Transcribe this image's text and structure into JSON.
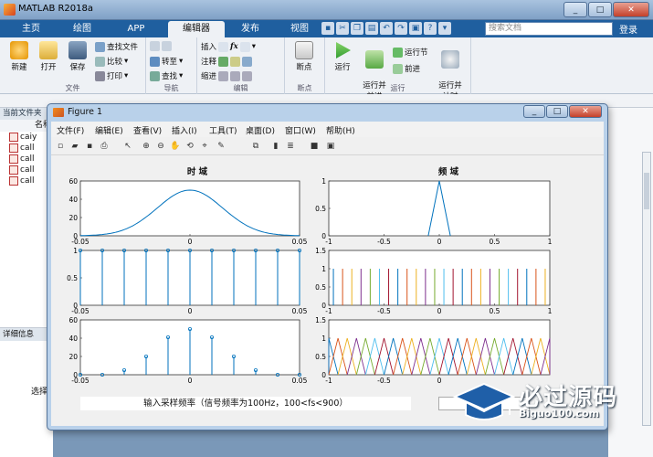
{
  "window": {
    "title": "MATLAB R2018a"
  },
  "tabs": [
    "主页",
    "绘图",
    "APP",
    "编辑器",
    "发布",
    "视图"
  ],
  "search": {
    "placeholder": "搜索文档"
  },
  "login_label": "登录",
  "ribbon": {
    "file": {
      "label": "文件",
      "new": "新建",
      "open": "打开",
      "save": "保存",
      "find_files": "查找文件",
      "compare": "比较",
      "print": "打印"
    },
    "navigate": {
      "label": "导航",
      "goto": "转至",
      "find": "查找"
    },
    "edit": {
      "label": "编辑",
      "insert": "插入",
      "comment": "注释",
      "indent": "缩进"
    },
    "breakpoints": {
      "label": "断点",
      "breakpoints_btn": "断点"
    },
    "run": {
      "label": "运行",
      "run": "运行",
      "run_advance": "运行并\n前进",
      "run_section": "运行节",
      "advance": "前进",
      "run_time": "运行并\n计时"
    }
  },
  "current_folder": {
    "label": "当前文件夹",
    "column": "名称",
    "files": [
      "caiy",
      "call",
      "call",
      "call",
      "call"
    ]
  },
  "details_panel": {
    "label": "详细信息",
    "select_text": "选择"
  },
  "figure": {
    "title": "Figure 1",
    "menus": [
      "文件(F)",
      "编辑(E)",
      "查看(V)",
      "插入(I)",
      "工具(T)",
      "桌面(D)",
      "窗口(W)",
      "帮助(H)"
    ],
    "plot_titles": {
      "time": "时 域",
      "freq": "频 域"
    },
    "fs_label": "输入采样频率（信号频率为100Hz，100<fs<900）",
    "fs_input_value": ""
  },
  "chart_data": [
    {
      "type": "line",
      "title": "时 域",
      "x": [
        -0.05,
        -0.04,
        -0.03,
        -0.02,
        -0.01,
        0,
        0.01,
        0.02,
        0.03,
        0.04,
        0.05
      ],
      "y": [
        0.4,
        3,
        11,
        26,
        42,
        50,
        42,
        26,
        11,
        3,
        0.4
      ],
      "xlim": [
        -0.05,
        0.05
      ],
      "ylim": [
        0,
        60
      ],
      "xticks": [
        "-0.05",
        "0",
        "0.05"
      ],
      "yticks": [
        "0",
        "20",
        "40",
        "60"
      ]
    },
    {
      "type": "line",
      "title": "频 域",
      "x": [
        -0.1,
        0,
        0.1
      ],
      "y": [
        0,
        1,
        0
      ],
      "xlim": [
        -1,
        1
      ],
      "ylim": [
        0,
        1
      ],
      "xticks": [
        "-1",
        "-0.5",
        "0",
        "0.5",
        "1"
      ],
      "yticks": [
        "0",
        "0.5",
        "1"
      ]
    },
    {
      "type": "stem",
      "x": [
        -0.05,
        -0.04,
        -0.03,
        -0.02,
        -0.01,
        0,
        0.01,
        0.02,
        0.03,
        0.04,
        0.05
      ],
      "y": [
        1,
        1,
        1,
        1,
        1,
        1,
        1,
        1,
        1,
        1,
        1
      ],
      "xlim": [
        -0.05,
        0.05
      ],
      "ylim": [
        0,
        1
      ],
      "xticks": [
        "-0.05",
        "0",
        "0.05"
      ],
      "yticks": [
        "0",
        "0.5",
        "1"
      ]
    },
    {
      "type": "line",
      "description_values": "impulse train of many colored lines",
      "x_count": 24,
      "xlim": [
        -1,
        1
      ],
      "ylim": [
        0,
        1.5
      ],
      "xticks": [
        "-1",
        "-0.5",
        "0",
        "0.5",
        "1"
      ],
      "yticks": [
        "0",
        "0.5",
        "1",
        "1.5"
      ]
    },
    {
      "type": "stem",
      "x": [
        -0.05,
        -0.04,
        -0.03,
        -0.02,
        -0.01,
        0,
        0.01,
        0.02,
        0.03,
        0.04,
        0.05
      ],
      "y": [
        0,
        0,
        5,
        20,
        41,
        50,
        41,
        20,
        5,
        0,
        0
      ],
      "xlim": [
        -0.05,
        0.05
      ],
      "ylim": [
        0,
        60
      ],
      "xticks": [
        "-0.05",
        "0",
        "0.05"
      ],
      "yticks": [
        "0",
        "20",
        "40",
        "60"
      ]
    },
    {
      "type": "line",
      "x_count": 24,
      "xlim": [
        -1,
        1
      ],
      "ylim": [
        0,
        1.5
      ],
      "xticks": [
        "-1",
        "-0.5",
        "0"
      ],
      "yticks": [
        "0",
        "0.5",
        "1",
        "1.5"
      ]
    }
  ],
  "colors": [
    "#0072BD",
    "#D95319",
    "#EDB120",
    "#7E2F8E",
    "#77AC30",
    "#4DBEEE",
    "#A2142F"
  ],
  "watermark": {
    "text": "必过源码",
    "url": "Biguo100.com"
  }
}
